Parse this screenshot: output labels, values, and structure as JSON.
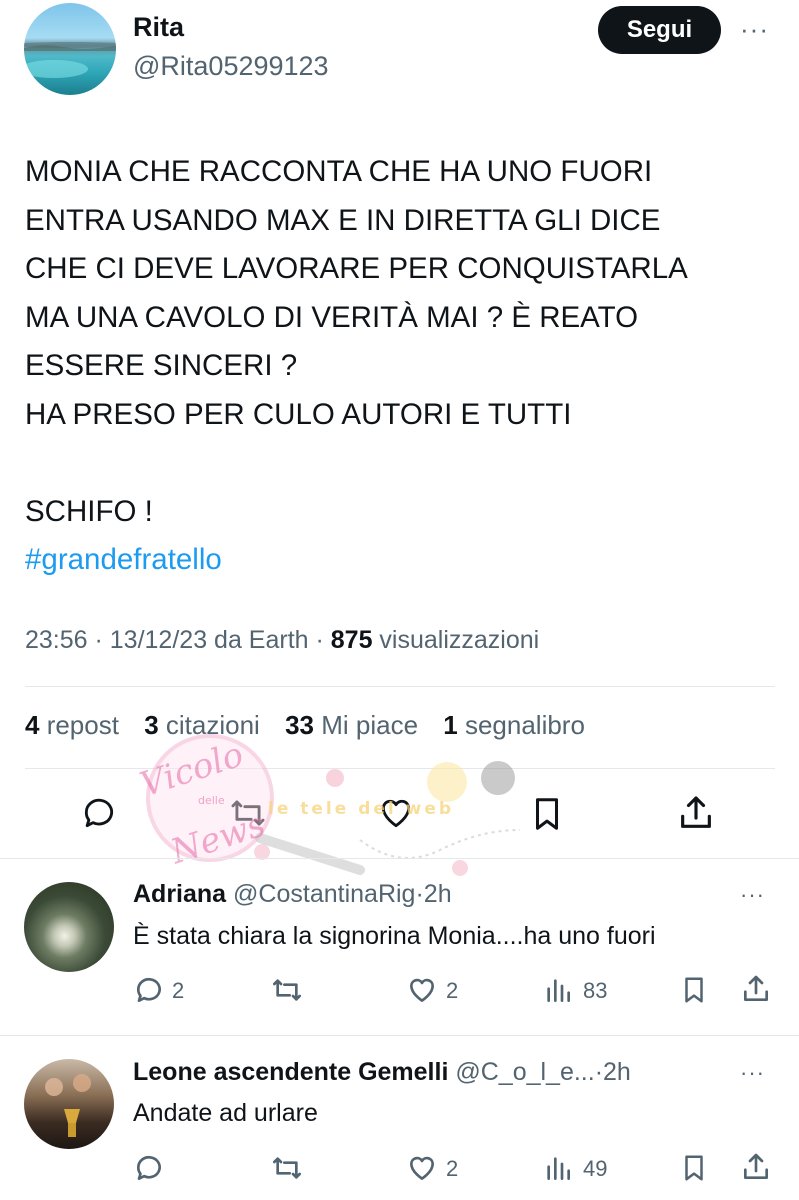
{
  "tweet": {
    "author_name": "Rita",
    "author_handle": "@Rita05299123",
    "follow_label": "Segui",
    "more_label": "···",
    "lines": [
      "MONIA CHE RACCONTA CHE HA UNO FUORI",
      "ENTRA USANDO MAX E IN DIRETTA GLI DICE",
      "CHE CI DEVE LAVORARE PER CONQUISTARLA",
      "MA UNA CAVOLO DI VERITÀ MAI ? È REATO",
      "ESSERE SINCERI ?",
      "HA PRESO PER CULO AUTORI E TUTTI",
      "SCHIFO !"
    ],
    "hashtag": "#grandefratello",
    "meta": {
      "time_date_source": "23:56 · 13/12/23 da Earth · ",
      "views_count": "875",
      "views_label": " visualizzazioni"
    },
    "stats": {
      "reposts_count": "4",
      "reposts_label": " repost",
      "quotes_count": "3",
      "quotes_label": " citazioni",
      "likes_count": "33",
      "likes_label": " Mi piace",
      "bookmarks_count": "1",
      "bookmarks_label": " segnalibro"
    }
  },
  "watermark": {
    "logo_text_1": "Vicolo",
    "logo_text_2": "delle",
    "logo_text_3": "News",
    "banner_text": "le tele del web"
  },
  "replies": [
    {
      "name": "Adriana",
      "handle": "@CostantinaRig",
      "time": "·2h",
      "text": "È stata chiara la signorina Monia....ha uno fuori",
      "reply_count": "2",
      "repost_count": "",
      "like_count": "2",
      "views_count": "83",
      "more_label": "···"
    },
    {
      "name": "Leone ascendente Gemelli",
      "handle": "@C_o_l_e...",
      "time": "·2h",
      "text": "Andate ad urlare",
      "reply_count": "",
      "repost_count": "",
      "like_count": "2",
      "views_count": "49",
      "more_label": "···"
    }
  ],
  "colors": {
    "accent": "#1d9bf0",
    "text": "#0f1419",
    "secondary": "#536471",
    "divider": "#e4e8eb",
    "watermark_pink": "#e86aa8"
  },
  "icons": [
    "reply-icon",
    "repost-icon",
    "like-icon",
    "bookmark-icon",
    "share-icon",
    "views-icon",
    "more-icon"
  ]
}
